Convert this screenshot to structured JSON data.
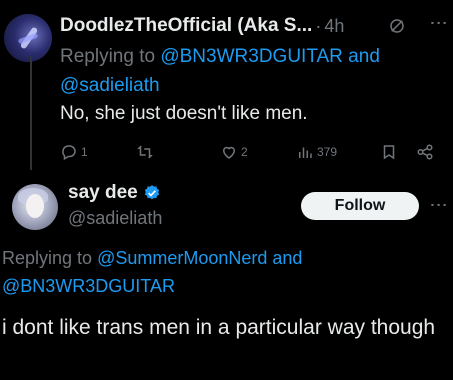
{
  "reply_tweet": {
    "display_name": "DoodlezTheOfficial (Aka S...",
    "separator": "·",
    "time": "4h",
    "replying_prefix": "Replying to ",
    "mention_1": "@BN3WR3DGUITAR",
    "and_word": " and",
    "mention_2": "@sadieliath",
    "text": "No, she just doesn't like men.",
    "reply_count": "1",
    "retweet_count": "",
    "like_count": "2",
    "view_count": "379"
  },
  "main_tweet": {
    "display_name": "say dee",
    "handle": "@sadieliath",
    "follow_label": "Follow",
    "replying_prefix": "Replying to ",
    "mention_1": "@SummerMoonNerd",
    "and_word": " and",
    "mention_2": "@BN3WR3DGUITAR",
    "text": "i dont like trans men in a particular way though"
  },
  "colors": {
    "background": "#000000",
    "text_primary": "#e7e9ea",
    "text_secondary": "#71767b",
    "accent_blue": "#1d9bf0",
    "follow_button_bg": "#eff3f4"
  }
}
